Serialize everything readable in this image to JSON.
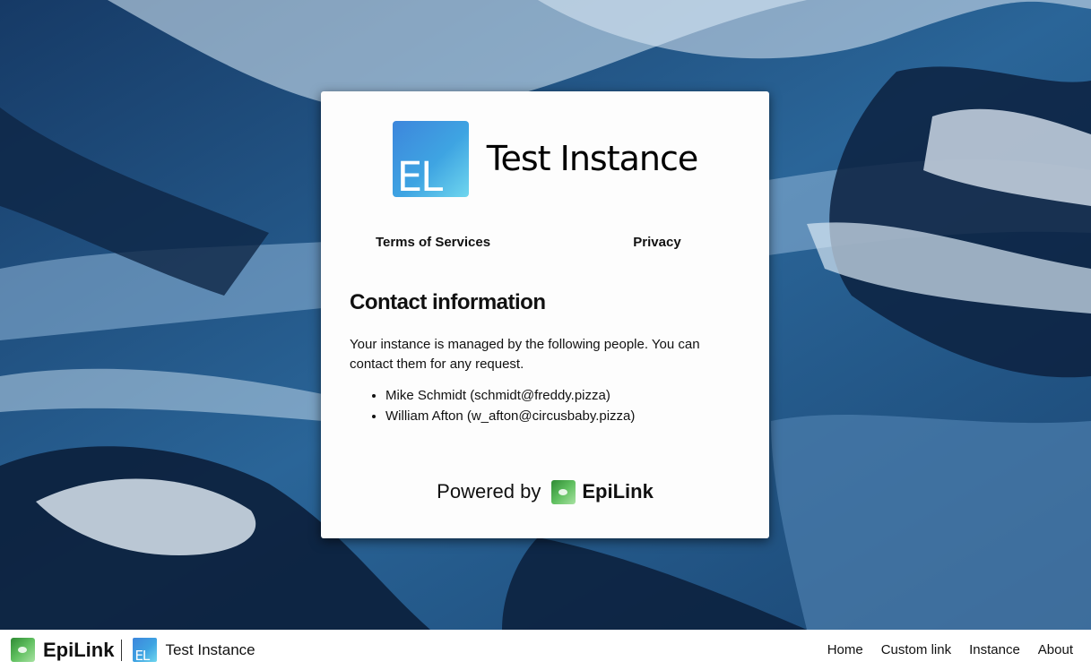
{
  "background": {
    "description_icon": "glacier-background"
  },
  "card": {
    "instance_name": "Test Instance",
    "logo_initials": "EL",
    "links": {
      "terms": "Terms of Services",
      "privacy": "Privacy"
    },
    "contact": {
      "heading": "Contact information",
      "text": "Your instance is managed by the following people. You can contact them for any request.",
      "people": [
        "Mike Schmidt (schmidt@freddy.pizza)",
        "William Afton (w_afton@circusbaby.pizza)"
      ]
    },
    "powered_by": {
      "label": "Powered by",
      "name": "EpiLink"
    }
  },
  "navbar": {
    "brand_name": "EpiLink",
    "instance_name": "Test Instance",
    "instance_logo_initials": "EL",
    "links": [
      "Home",
      "Custom link",
      "Instance",
      "About"
    ]
  },
  "colors": {
    "instance_logo": "#3ea4e2",
    "epilink_logo": "#5fbf5f",
    "background": "#1d4a78"
  }
}
